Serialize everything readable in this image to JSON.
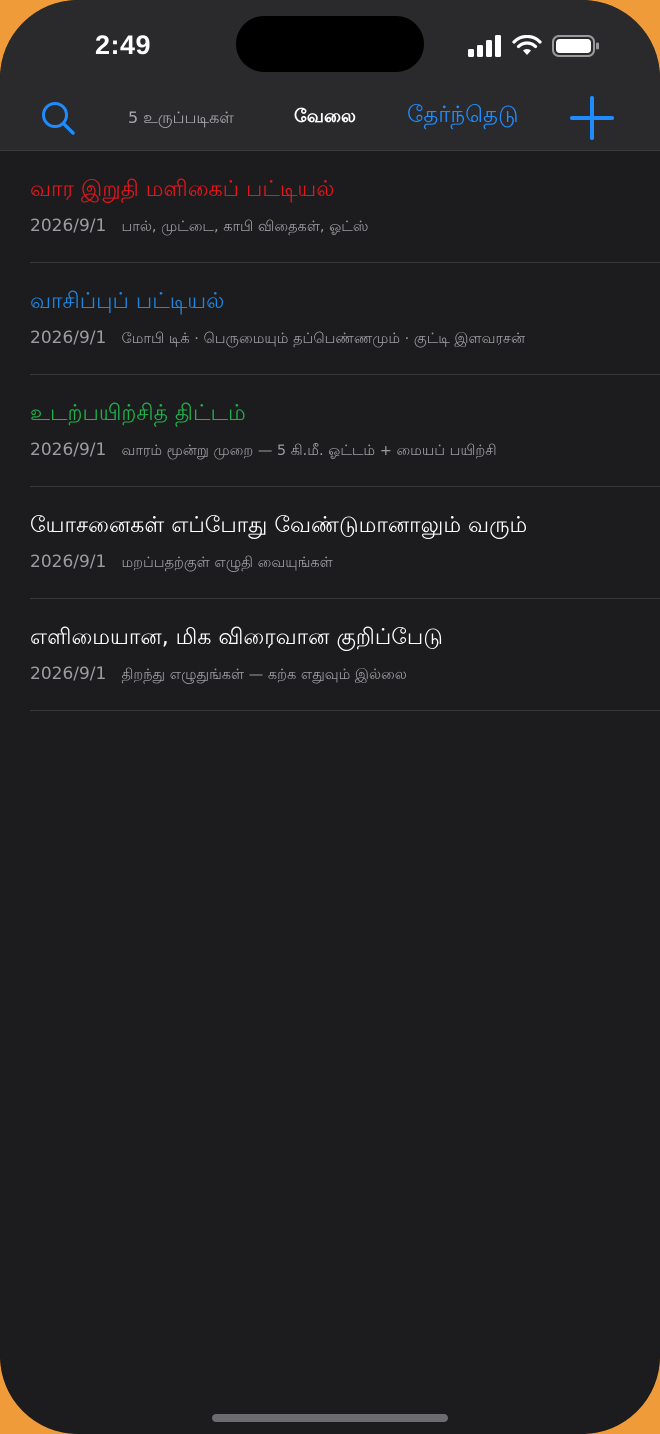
{
  "status_bar": {
    "time": "2:49"
  },
  "nav": {
    "count_label": "5 உருப்படிகள்",
    "title": "வேலை",
    "select_label": "தேர்ந்தெடு",
    "search_icon": "search-icon",
    "add_icon": "plus-icon"
  },
  "colors": {
    "accent": "#1e8cff",
    "red": "#e3161c",
    "blue": "#1f86e0",
    "green": "#1fb04a",
    "white": "#ffffff",
    "background": "#1c1c1e"
  },
  "notes": [
    {
      "title": "வார இறுதி மளிகைப் பட்டியல்",
      "color": "#e3161c",
      "date": "2026/9/1",
      "preview": "பால், முட்டை, காபி விதைகள், ஓட்ஸ்"
    },
    {
      "title": "வாசிப்புப் பட்டியல்",
      "color": "#1f86e0",
      "date": "2026/9/1",
      "preview": "மோபி டிக் · பெருமையும் தப்பெண்ணமும் · குட்டி இளவரசன்"
    },
    {
      "title": "உடற்பயிற்சித் திட்டம்",
      "color": "#1fb04a",
      "date": "2026/9/1",
      "preview": "வாரம் மூன்று முறை — 5 கி.மீ. ஓட்டம் + மையப் பயிற்சி"
    },
    {
      "title": "யோசனைகள் எப்போது வேண்டுமானாலும் வரும்",
      "color": "#ffffff",
      "date": "2026/9/1",
      "preview": "மறப்பதற்குள் எழுதி வையுங்கள்"
    },
    {
      "title": "எளிமையான, மிக விரைவான குறிப்பேடு",
      "color": "#ffffff",
      "date": "2026/9/1",
      "preview": "திறந்து எழுதுங்கள் — கற்க எதுவும் இல்லை"
    }
  ]
}
